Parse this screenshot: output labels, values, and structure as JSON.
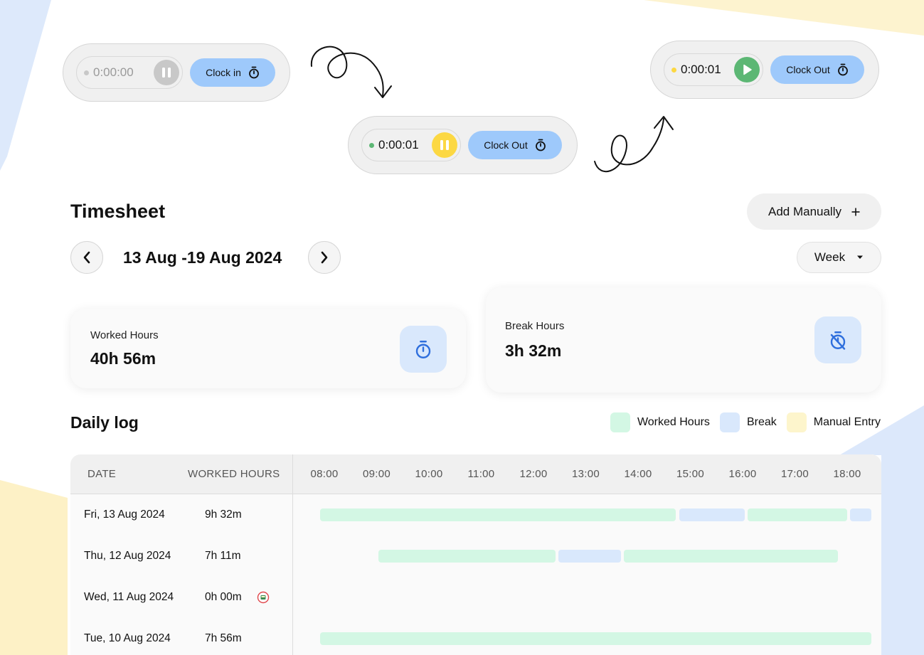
{
  "colors": {
    "worked": "#d3f7e4",
    "break": "#d9e8fc",
    "manual": "#fdf5cc",
    "accent_blue": "#9ec9fb",
    "paused_yellow": "#fcd843",
    "play_green": "#5cb774",
    "idle_gray": "#c8c8c8"
  },
  "timers": {
    "idle": {
      "time": "0:00:00",
      "button": "Clock in",
      "state_icon": "pause-icon"
    },
    "running": {
      "time": "0:00:01",
      "button": "Clock Out",
      "state_icon": "pause-icon"
    },
    "paused": {
      "time": "0:00:01",
      "button": "Clock Out",
      "state_icon": "play-icon"
    }
  },
  "timesheet": {
    "title": "Timesheet",
    "add_manually": "Add Manually",
    "date_range": "13 Aug -19 Aug 2024",
    "period": "Week"
  },
  "summary": {
    "worked_label": "Worked Hours",
    "worked_value": "40h 56m",
    "break_label": "Break Hours",
    "break_value": "3h 32m"
  },
  "daily_log": {
    "title": "Daily log",
    "legend": [
      "Worked Hours",
      "Break",
      "Manual Entry"
    ],
    "columns": [
      "DATE",
      "WORKED HOURS"
    ],
    "hours": [
      "08:00",
      "09:00",
      "10:00",
      "11:00",
      "12:00",
      "13:00",
      "14:00",
      "15:00",
      "16:00",
      "17:00",
      "18:00"
    ],
    "rows": [
      {
        "date": "Fri, 13 Aug 2024",
        "worked": "9h 32m",
        "segments": [
          {
            "type": "worked",
            "start": 8.0,
            "end": 14.8
          },
          {
            "type": "break",
            "start": 14.87,
            "end": 16.12
          },
          {
            "type": "worked",
            "start": 16.18,
            "end": 18.08
          },
          {
            "type": "break",
            "start": 18.14,
            "end": 18.55
          }
        ]
      },
      {
        "date": "Thu, 12 Aug 2024",
        "worked": "7h 11m",
        "segments": [
          {
            "type": "worked",
            "start": 9.12,
            "end": 12.5
          },
          {
            "type": "break",
            "start": 12.56,
            "end": 13.75
          },
          {
            "type": "worked",
            "start": 13.81,
            "end": 17.9
          }
        ]
      },
      {
        "date": "Wed, 11 Aug 2024",
        "worked": "0h 00m",
        "flag": "no-entry-icon",
        "segments": []
      },
      {
        "date": "Tue, 10 Aug 2024",
        "worked": "7h 56m",
        "segments": [
          {
            "type": "worked",
            "start": 8.0,
            "end": 18.55
          }
        ]
      }
    ]
  }
}
